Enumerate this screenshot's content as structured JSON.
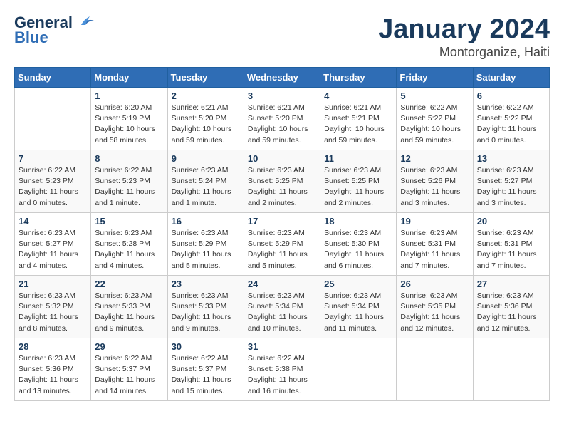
{
  "header": {
    "logo_line1": "General",
    "logo_line2": "Blue",
    "month": "January 2024",
    "location": "Montorganize, Haiti"
  },
  "days_of_week": [
    "Sunday",
    "Monday",
    "Tuesday",
    "Wednesday",
    "Thursday",
    "Friday",
    "Saturday"
  ],
  "weeks": [
    [
      {
        "num": "",
        "info": ""
      },
      {
        "num": "1",
        "info": "Sunrise: 6:20 AM\nSunset: 5:19 PM\nDaylight: 10 hours\nand 58 minutes."
      },
      {
        "num": "2",
        "info": "Sunrise: 6:21 AM\nSunset: 5:20 PM\nDaylight: 10 hours\nand 59 minutes."
      },
      {
        "num": "3",
        "info": "Sunrise: 6:21 AM\nSunset: 5:20 PM\nDaylight: 10 hours\nand 59 minutes."
      },
      {
        "num": "4",
        "info": "Sunrise: 6:21 AM\nSunset: 5:21 PM\nDaylight: 10 hours\nand 59 minutes."
      },
      {
        "num": "5",
        "info": "Sunrise: 6:22 AM\nSunset: 5:22 PM\nDaylight: 10 hours\nand 59 minutes."
      },
      {
        "num": "6",
        "info": "Sunrise: 6:22 AM\nSunset: 5:22 PM\nDaylight: 11 hours\nand 0 minutes."
      }
    ],
    [
      {
        "num": "7",
        "info": "Sunrise: 6:22 AM\nSunset: 5:23 PM\nDaylight: 11 hours\nand 0 minutes."
      },
      {
        "num": "8",
        "info": "Sunrise: 6:22 AM\nSunset: 5:23 PM\nDaylight: 11 hours\nand 1 minute."
      },
      {
        "num": "9",
        "info": "Sunrise: 6:23 AM\nSunset: 5:24 PM\nDaylight: 11 hours\nand 1 minute."
      },
      {
        "num": "10",
        "info": "Sunrise: 6:23 AM\nSunset: 5:25 PM\nDaylight: 11 hours\nand 2 minutes."
      },
      {
        "num": "11",
        "info": "Sunrise: 6:23 AM\nSunset: 5:25 PM\nDaylight: 11 hours\nand 2 minutes."
      },
      {
        "num": "12",
        "info": "Sunrise: 6:23 AM\nSunset: 5:26 PM\nDaylight: 11 hours\nand 3 minutes."
      },
      {
        "num": "13",
        "info": "Sunrise: 6:23 AM\nSunset: 5:27 PM\nDaylight: 11 hours\nand 3 minutes."
      }
    ],
    [
      {
        "num": "14",
        "info": "Sunrise: 6:23 AM\nSunset: 5:27 PM\nDaylight: 11 hours\nand 4 minutes."
      },
      {
        "num": "15",
        "info": "Sunrise: 6:23 AM\nSunset: 5:28 PM\nDaylight: 11 hours\nand 4 minutes."
      },
      {
        "num": "16",
        "info": "Sunrise: 6:23 AM\nSunset: 5:29 PM\nDaylight: 11 hours\nand 5 minutes."
      },
      {
        "num": "17",
        "info": "Sunrise: 6:23 AM\nSunset: 5:29 PM\nDaylight: 11 hours\nand 5 minutes."
      },
      {
        "num": "18",
        "info": "Sunrise: 6:23 AM\nSunset: 5:30 PM\nDaylight: 11 hours\nand 6 minutes."
      },
      {
        "num": "19",
        "info": "Sunrise: 6:23 AM\nSunset: 5:31 PM\nDaylight: 11 hours\nand 7 minutes."
      },
      {
        "num": "20",
        "info": "Sunrise: 6:23 AM\nSunset: 5:31 PM\nDaylight: 11 hours\nand 7 minutes."
      }
    ],
    [
      {
        "num": "21",
        "info": "Sunrise: 6:23 AM\nSunset: 5:32 PM\nDaylight: 11 hours\nand 8 minutes."
      },
      {
        "num": "22",
        "info": "Sunrise: 6:23 AM\nSunset: 5:33 PM\nDaylight: 11 hours\nand 9 minutes."
      },
      {
        "num": "23",
        "info": "Sunrise: 6:23 AM\nSunset: 5:33 PM\nDaylight: 11 hours\nand 9 minutes."
      },
      {
        "num": "24",
        "info": "Sunrise: 6:23 AM\nSunset: 5:34 PM\nDaylight: 11 hours\nand 10 minutes."
      },
      {
        "num": "25",
        "info": "Sunrise: 6:23 AM\nSunset: 5:34 PM\nDaylight: 11 hours\nand 11 minutes."
      },
      {
        "num": "26",
        "info": "Sunrise: 6:23 AM\nSunset: 5:35 PM\nDaylight: 11 hours\nand 12 minutes."
      },
      {
        "num": "27",
        "info": "Sunrise: 6:23 AM\nSunset: 5:36 PM\nDaylight: 11 hours\nand 12 minutes."
      }
    ],
    [
      {
        "num": "28",
        "info": "Sunrise: 6:23 AM\nSunset: 5:36 PM\nDaylight: 11 hours\nand 13 minutes."
      },
      {
        "num": "29",
        "info": "Sunrise: 6:22 AM\nSunset: 5:37 PM\nDaylight: 11 hours\nand 14 minutes."
      },
      {
        "num": "30",
        "info": "Sunrise: 6:22 AM\nSunset: 5:37 PM\nDaylight: 11 hours\nand 15 minutes."
      },
      {
        "num": "31",
        "info": "Sunrise: 6:22 AM\nSunset: 5:38 PM\nDaylight: 11 hours\nand 16 minutes."
      },
      {
        "num": "",
        "info": ""
      },
      {
        "num": "",
        "info": ""
      },
      {
        "num": "",
        "info": ""
      }
    ]
  ]
}
